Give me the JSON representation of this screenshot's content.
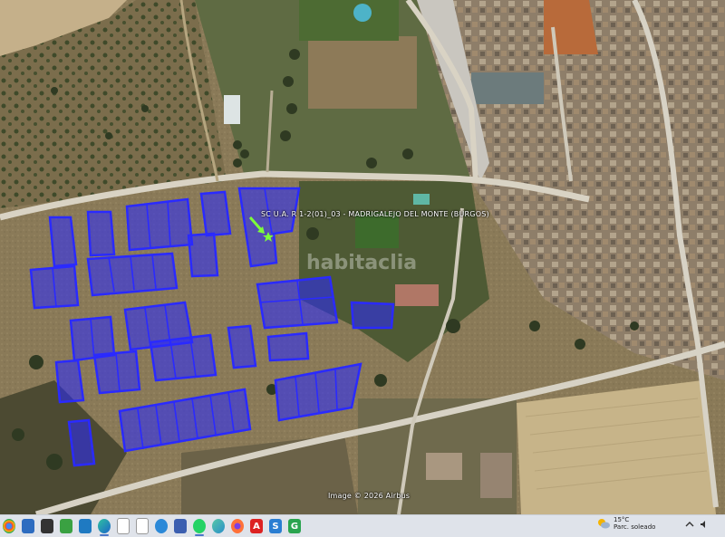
{
  "map": {
    "parcel_label": "SC U.A. R 1-2(01)_03 - MADRIGALEJO DEL MONTE (BURGOS)",
    "attribution": "Image © 2026 Airbus",
    "watermark": "habitaclia",
    "fill_color": "#2a2aff",
    "marker_color": "#7dff3a"
  },
  "taskbar": {
    "icons": [
      "chrome-icon",
      "desktop-icon",
      "task-view-icon",
      "network-icon",
      "photos-icon",
      "edge-icon",
      "file-icon",
      "video-icon",
      "maps-icon",
      "save-icon",
      "whatsapp-icon",
      "edge-alt-icon",
      "firefox-icon",
      "pdf-icon",
      "app-s-icon",
      "app-g-icon"
    ],
    "weather": {
      "temperature": "15°C",
      "condition": "Parc. soleado"
    }
  }
}
